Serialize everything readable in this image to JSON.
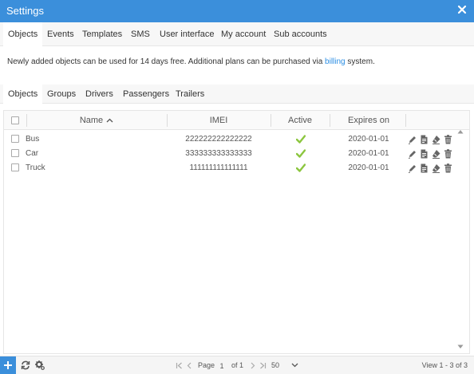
{
  "window": {
    "title": "Settings",
    "close_icon": "close-icon"
  },
  "top_tabs": [
    {
      "label": "Objects"
    },
    {
      "label": "Events"
    },
    {
      "label": "Templates"
    },
    {
      "label": "SMS"
    },
    {
      "label": "User interface"
    },
    {
      "label": "My account"
    },
    {
      "label": "Sub accounts"
    }
  ],
  "notice": {
    "text_before": "Newly added objects can be used for 14 days free. Additional plans can be purchased via ",
    "link_text": "billing",
    "text_after": " system."
  },
  "sub_tabs": [
    {
      "label": "Objects"
    },
    {
      "label": "Groups"
    },
    {
      "label": "Drivers"
    },
    {
      "label": "Passengers"
    },
    {
      "label": "Trailers"
    }
  ],
  "grid": {
    "columns": {
      "name": "Name",
      "imei": "IMEI",
      "active": "Active",
      "expires": "Expires on"
    },
    "rows": [
      {
        "name": "Bus",
        "imei": "222222222222222",
        "active": true,
        "expires": "2020-01-01"
      },
      {
        "name": "Car",
        "imei": "333333333333333",
        "active": true,
        "expires": "2020-01-01"
      },
      {
        "name": "Truck",
        "imei": "111111111111111",
        "active": true,
        "expires": "2020-01-01"
      }
    ],
    "row_action_icons": [
      "edit-icon",
      "duplicate-icon",
      "clear-icon",
      "delete-icon"
    ]
  },
  "footer": {
    "page_label": "Page",
    "page_value": "1",
    "of_label": "of 1",
    "rows_per_page": "50",
    "view_info": "View 1 - 3 of 3"
  },
  "colors": {
    "accent": "#3b8fdb",
    "link": "#2a8de3",
    "check": "#8cc63f",
    "icon": "#666666"
  }
}
